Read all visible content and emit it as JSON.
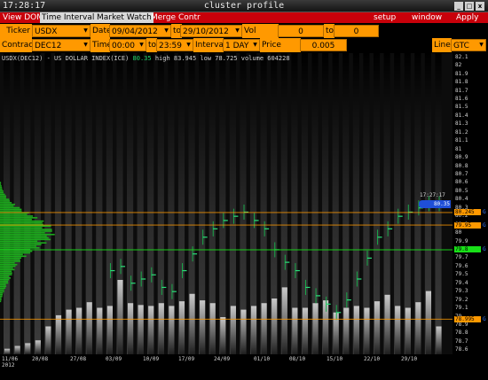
{
  "window": {
    "clock": "17:28:17",
    "title": "cluster profile",
    "buttons": [
      "_",
      "□",
      "x"
    ]
  },
  "menu": {
    "items": [
      "View DOM",
      "Time Interval",
      "Market Watch",
      "Merge Contr"
    ],
    "right_items": [
      "setup",
      "window",
      "Apply"
    ],
    "selected": [
      "Time Interval",
      "Market Watch"
    ]
  },
  "controls": {
    "ticker_label": "Ticker",
    "ticker_value": "USDX",
    "date_label": "Date",
    "date_from": "09/04/2012",
    "to_label": "to",
    "date_to": "29/10/2012",
    "vol_range_label": "Vol range",
    "vol_from": "0",
    "vol_to_label": "to",
    "vol_to": "0",
    "contract_label": "Contract",
    "contract_value": "DEC12",
    "time_label": "Time",
    "time_from": "00:00",
    "time_to_label": "to",
    "time_to": "23:59",
    "interval_label": "Interval",
    "interval_value": "1 DAY",
    "price_scale_label": "Price Scale",
    "price_scale_value": "0.005",
    "line_label": "Line",
    "line_value": "GTC"
  },
  "chart_info": {
    "symbol": "USDX(DEC12) - US DOLLAR INDEX(ICE)",
    "last": "80.35",
    "stats": "high 83.945  low 78.725  volume 604228"
  },
  "chart_data": {
    "type": "bar",
    "title": "",
    "y_axis_ticks": [
      82.1,
      82,
      81.9,
      81.8,
      81.7,
      81.6,
      81.5,
      81.4,
      81.3,
      81.2,
      81.1,
      81,
      80.9,
      80.8,
      80.7,
      80.6,
      80.5,
      80.4,
      80.3,
      80.2,
      80.1,
      80,
      79.9,
      79.8,
      79.7,
      79.6,
      79.5,
      79.4,
      79.3,
      79.2,
      79.1,
      79,
      78.9,
      78.8,
      78.7,
      78.6
    ],
    "y_axis_tick_labels": [
      "82.1",
      "82",
      "81.9",
      "81.8",
      "81.7",
      "81.6",
      "81.5",
      "81.4",
      "81.3",
      "81.2",
      "81.1",
      "81",
      "80.9",
      "80.8",
      "80.7",
      "80.6",
      "80.5",
      "80.4",
      "80.3",
      "80.2",
      "80.1",
      "80",
      "79.9",
      "79.8",
      "79.7",
      "79.6",
      "79.5",
      "79.4",
      "79.3",
      "79.2",
      "79.1",
      "79",
      "78.9",
      "78.8",
      "78.7",
      "78.6"
    ],
    "ylim": [
      78.55,
      82.15
    ],
    "x_tick_labels": [
      "11/06",
      "20/08",
      "27/08",
      "03/09",
      "10/09",
      "17/09",
      "24/09",
      "01/10",
      "08/10",
      "15/10",
      "22/10",
      "29/10"
    ],
    "x_year_label": "2012",
    "volume_bars": [
      0.06,
      0.09,
      0.12,
      0.15,
      0.3,
      0.42,
      0.48,
      0.5,
      0.56,
      0.5,
      0.52,
      0.8,
      0.55,
      0.53,
      0.52,
      0.55,
      0.52,
      0.57,
      0.65,
      0.58,
      0.55,
      0.4,
      0.52,
      0.48,
      0.52,
      0.55,
      0.6,
      0.72,
      0.5,
      0.5,
      0.55,
      0.58,
      0.45,
      0.5,
      0.52,
      0.5,
      0.57,
      0.64,
      0.52,
      0.5,
      0.56,
      0.68,
      0.3
    ],
    "levels": [
      {
        "price": 80.245,
        "label": "80.245",
        "color": "#ff9900",
        "flag": "G"
      },
      {
        "price": 80.095,
        "label": "79.95",
        "color": "#ff9900",
        "flag": "G"
      },
      {
        "price": 79.8,
        "label": "79.8",
        "color": "#18e018",
        "flag": "G"
      },
      {
        "price": 78.97,
        "label": "78.995",
        "color": "#ff9900",
        "flag": "G"
      }
    ],
    "current_price": {
      "value": 80.35,
      "label": "80.35",
      "time": "17:27:17"
    }
  },
  "colors": {
    "menubar": "#c8000a",
    "control": "#ff9900",
    "profile": "#1cab1c",
    "current": "#1f4fd8"
  }
}
